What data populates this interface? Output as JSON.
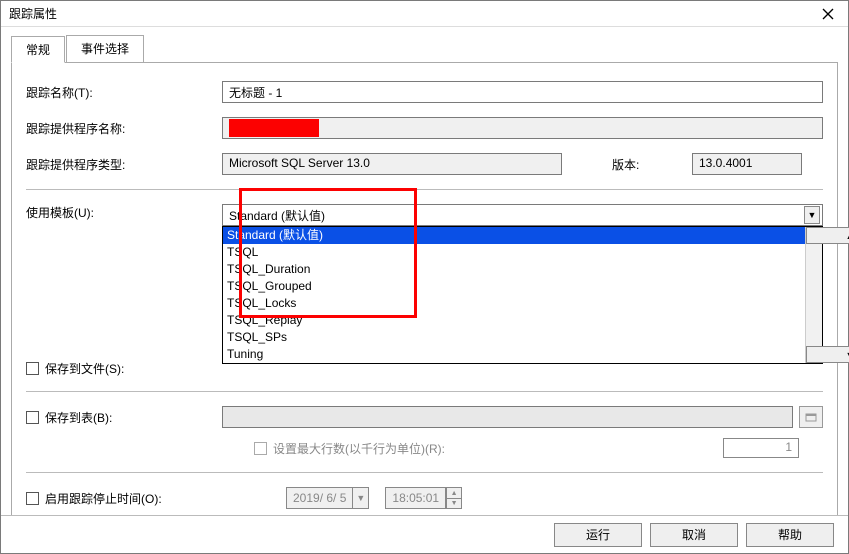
{
  "window": {
    "title": "跟踪属性"
  },
  "tabs": [
    {
      "label": "常规",
      "active": true
    },
    {
      "label": "事件选择",
      "active": false
    }
  ],
  "fields": {
    "trace_name_label": "跟踪名称(T):",
    "trace_name_value": "无标题 - 1",
    "provider_name_label": "跟踪提供程序名称:",
    "provider_type_label": "跟踪提供程序类型:",
    "provider_type_value": "Microsoft SQL Server 13.0",
    "version_label": "版本:",
    "version_value": "13.0.4001",
    "use_template_label": "使用模板(U):",
    "template_selected": "Standard (默认值)",
    "template_options": [
      "Standard (默认值)",
      "TSQL",
      "TSQL_Duration",
      "TSQL_Grouped",
      "TSQL_Locks",
      "TSQL_Replay",
      "TSQL_SPs",
      "Tuning"
    ],
    "save_to_file_label": "保存到文件(S):",
    "save_to_table_label": "保存到表(B):",
    "set_max_rows_label": "设置最大行数(以千行为单位)(R):",
    "set_max_rows_value": "1",
    "enable_stop_time_label": "启用跟踪停止时间(O):",
    "stop_date": "2019/ 6/ 5",
    "stop_time": "18:05:01"
  },
  "buttons": {
    "run": "运行",
    "cancel": "取消",
    "help": "帮助"
  }
}
